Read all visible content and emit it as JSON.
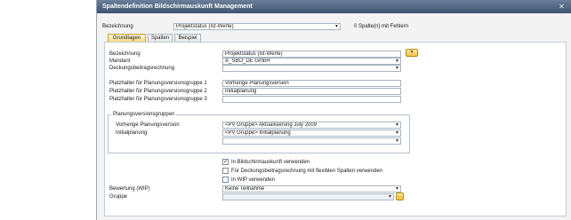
{
  "window": {
    "title": "Spaltendefinition Bildschirmauskunft Management",
    "close_glyph": "✕"
  },
  "header": {
    "bezeichnung_label": "Bezeichnung",
    "bezeichnung_value": "Projektstatus (Ist-Werte)",
    "status_text": "0 Spalte(n) mit Fehlern"
  },
  "tabs": [
    {
      "label": "Grundlagen",
      "active": true
    },
    {
      "label": "Spalten",
      "active": false
    },
    {
      "label": "Beispiel",
      "active": false
    }
  ],
  "form": {
    "bezeichnung": {
      "label": "Bezeichnung",
      "value": "Projektstatus (Ist-Werte)"
    },
    "mandant": {
      "label": "Mandant",
      "value": "A_SBO_DE GmbH"
    },
    "deckungsbeitrag": {
      "label": "Deckungsbeitragsrechnung",
      "value": ""
    },
    "platzhalter1": {
      "label": "Platzhalter für Planungsversionsgruppe 1",
      "value": "Vorherige Planungsversion"
    },
    "platzhalter2": {
      "label": "Platzhalter für Planungsversionsgruppe 2",
      "value": "Initialplanung"
    },
    "platzhalter3": {
      "label": "Platzhalter für Planungsversionsgruppe 3",
      "value": ""
    }
  },
  "group": {
    "title": "Planungsversionsgruppen",
    "rows": [
      {
        "label": "Vorherige Planungsversion",
        "value": "<PV Gruppe> Aktualisierung July 2009"
      },
      {
        "label": "Initialplanung",
        "value": "<PV Gruppe> Initialplanung"
      },
      {
        "label": "",
        "value": ""
      }
    ]
  },
  "checks": [
    {
      "label": "In Bildschirmauskunft verwenden",
      "checked": true,
      "mark": "✓"
    },
    {
      "label": "Für Deckungsbeitragsrechnung mit flexiblen Spalten verwenden",
      "checked": false,
      "mark": ""
    },
    {
      "label": "In WIP verwenden",
      "checked": false,
      "mark": ""
    }
  ],
  "bewertung": {
    "label": "Bewertung (WIP)",
    "value": "Keine Teilnahme"
  },
  "gruppe": {
    "label": "Gruppe",
    "value": "",
    "button": "..."
  },
  "yellow_button_glyph": "▾"
}
